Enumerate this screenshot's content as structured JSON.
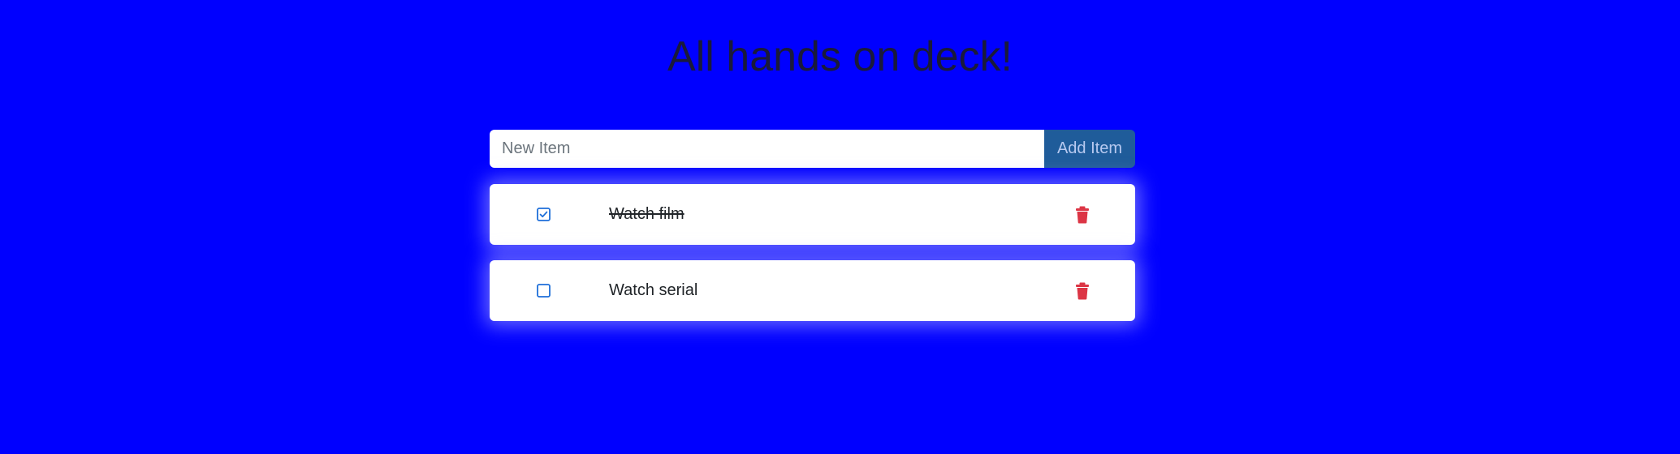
{
  "header": {
    "title": "All hands on deck!"
  },
  "form": {
    "input_placeholder": "New Item",
    "input_value": "",
    "add_button_label": "Add Item"
  },
  "todos": [
    {
      "label": "Watch film",
      "checked": true,
      "delete_icon": "trash-icon"
    },
    {
      "label": "Watch serial",
      "checked": false,
      "delete_icon": "trash-icon"
    }
  ],
  "colors": {
    "background": "#0000ff",
    "accent": "#1f5c9a",
    "checkbox": "#1e6fd9",
    "delete": "#dc3545"
  }
}
